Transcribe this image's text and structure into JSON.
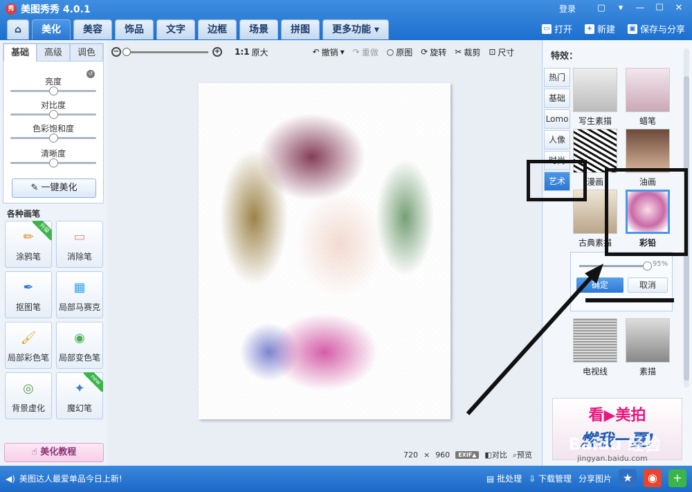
{
  "app": {
    "title": "美图秀秀 4.0.1",
    "logo": "秀",
    "login": "登录"
  },
  "window_controls": {
    "message": "▢",
    "skin": "▾",
    "minimize": "—",
    "maximize": "☐",
    "close": "✕"
  },
  "tabs": [
    {
      "label": "⌂"
    },
    {
      "label": "美化"
    },
    {
      "label": "美容"
    },
    {
      "label": "饰品"
    },
    {
      "label": "文字"
    },
    {
      "label": "边框"
    },
    {
      "label": "场景"
    },
    {
      "label": "拼图"
    },
    {
      "label": "更多功能 ▾"
    }
  ],
  "top_actions": {
    "open": "打开",
    "new": "新建",
    "save_share": "保存与分享"
  },
  "left_panel": {
    "tabs": [
      "基础",
      "高级",
      "调色"
    ],
    "sliders": [
      {
        "label": "亮度",
        "value": 0.5
      },
      {
        "label": "对比度",
        "value": 0.5
      },
      {
        "label": "色彩饱和度",
        "value": 0.5
      },
      {
        "label": "清晰度",
        "value": 0.5
      }
    ],
    "onekey": "一键美化",
    "brush_title": "各种画笔",
    "brushes": [
      {
        "label": "涂鸦笔",
        "icon": "✏",
        "badge": "升级"
      },
      {
        "label": "消除笔",
        "icon": "▭",
        "badge": ""
      },
      {
        "label": "抠图笔",
        "icon": "✒",
        "badge": ""
      },
      {
        "label": "局部马赛克",
        "icon": "▦",
        "badge": ""
      },
      {
        "label": "局部彩色笔",
        "icon": "🖌",
        "badge": ""
      },
      {
        "label": "局部变色笔",
        "icon": "◉",
        "badge": ""
      },
      {
        "label": "背景虚化",
        "icon": "◎",
        "badge": ""
      },
      {
        "label": "魔幻笔",
        "icon": "✦",
        "badge": "new"
      }
    ],
    "tutorial": "美化教程"
  },
  "toolbar": {
    "ratio": "1:1",
    "original_size": "原大",
    "undo": "撤销",
    "redo": "重做",
    "original": "原图",
    "rotate": "旋转",
    "crop": "裁剪",
    "size": "尺寸"
  },
  "image_info": {
    "width": "720",
    "times": "×",
    "height": "960",
    "exif": "EXIF▲",
    "compare": "对比",
    "preview": "预览"
  },
  "right_panel": {
    "title": "特效：",
    "categories": [
      "热门",
      "基础",
      "Lomo",
      "人像",
      "时尚",
      "艺术"
    ],
    "active_category": "艺术",
    "effects": [
      {
        "label": "写生素描"
      },
      {
        "label": "蜡笔"
      },
      {
        "label": "漫画"
      },
      {
        "label": "油画"
      },
      {
        "label": "古典素描"
      },
      {
        "label": "彩铅"
      },
      {
        "label": "电视线"
      },
      {
        "label": "素描"
      }
    ],
    "selected_effect": "彩铅",
    "popup": {
      "percent": "95%",
      "value": 0.95,
      "ok": "确定",
      "cancel": "取消"
    },
    "ad": {
      "line1": "看▶美拍",
      "line2": "燃我一夏!"
    }
  },
  "statusbar": {
    "message": "美图达人最爱单品今日上新!",
    "batch": "批处理",
    "download": "下载管理",
    "share": "分享图片"
  },
  "watermark": {
    "text": "Baidu 经验",
    "url": "jingyan.baidu.com"
  }
}
